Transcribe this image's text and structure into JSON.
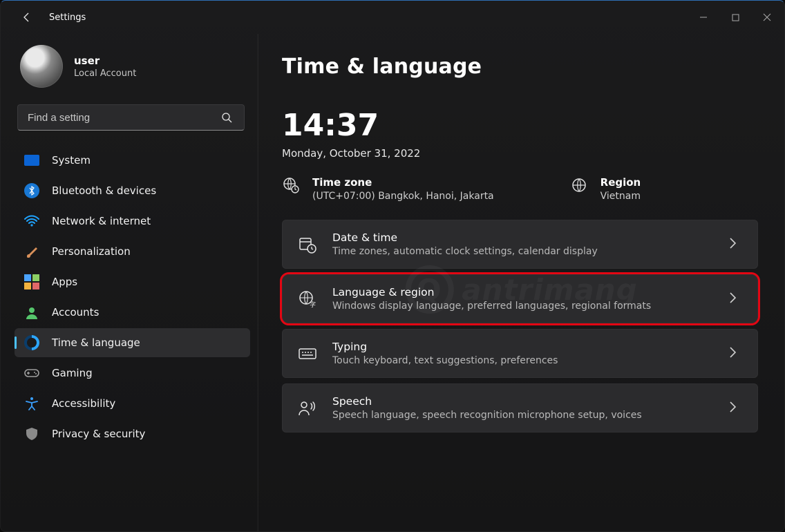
{
  "window": {
    "title": "Settings"
  },
  "profile": {
    "name": "user",
    "subtitle": "Local Account"
  },
  "search": {
    "placeholder": "Find a setting"
  },
  "sidebar": {
    "items": [
      {
        "label": "System"
      },
      {
        "label": "Bluetooth & devices"
      },
      {
        "label": "Network & internet"
      },
      {
        "label": "Personalization"
      },
      {
        "label": "Apps"
      },
      {
        "label": "Accounts"
      },
      {
        "label": "Time & language"
      },
      {
        "label": "Gaming"
      },
      {
        "label": "Accessibility"
      },
      {
        "label": "Privacy & security"
      }
    ],
    "activeIndex": 6
  },
  "main": {
    "title": "Time & language",
    "clock": "14:37",
    "date": "Monday, October 31, 2022",
    "timezone": {
      "label": "Time zone",
      "value": "(UTC+07:00) Bangkok, Hanoi, Jakarta"
    },
    "region": {
      "label": "Region",
      "value": "Vietnam"
    },
    "cards": [
      {
        "title": "Date & time",
        "subtitle": "Time zones, automatic clock settings, calendar display",
        "highlight": false
      },
      {
        "title": "Language & region",
        "subtitle": "Windows display language, preferred languages, regional formats",
        "highlight": true
      },
      {
        "title": "Typing",
        "subtitle": "Touch keyboard, text suggestions, preferences",
        "highlight": false
      },
      {
        "title": "Speech",
        "subtitle": "Speech language, speech recognition microphone setup, voices",
        "highlight": false
      }
    ]
  },
  "watermark": {
    "text": "antrimang"
  }
}
